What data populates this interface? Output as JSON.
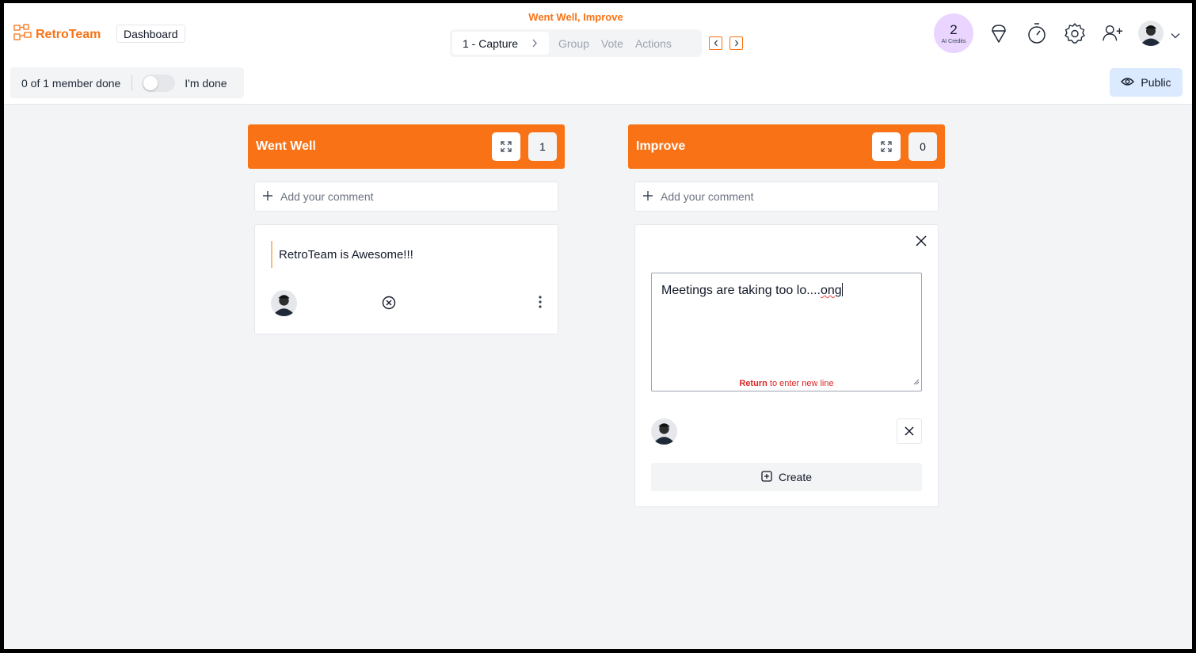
{
  "app": {
    "logo_text": "RetroTeam",
    "dashboard_label": "Dashboard",
    "board_title": "Went Well, Improve"
  },
  "steps": {
    "active": "1 - Capture",
    "items": [
      "Group",
      "Vote",
      "Actions"
    ]
  },
  "credits": {
    "count": "2",
    "label": "AI Credits"
  },
  "status": {
    "members_done": "0 of 1 member done",
    "done_toggle_label": "I'm done",
    "done_toggle_on": false
  },
  "visibility": {
    "label": "Public"
  },
  "columns": [
    {
      "title": "Went Well",
      "count": "1",
      "add_comment_placeholder": "Add your comment",
      "cards": [
        {
          "text": "RetroTeam is Awesome!!!"
        }
      ]
    },
    {
      "title": "Improve",
      "count": "0",
      "add_comment_placeholder": "Add your comment",
      "draft": {
        "text_before": "Meetings are taking too lo....",
        "text_misspelled": "ong",
        "hint_key": "Return",
        "hint_text": " to enter new line",
        "create_label": "Create"
      }
    }
  ],
  "colors": {
    "accent": "#f97316",
    "credits_bg": "#e9d5ff",
    "public_bg": "#dbeafe",
    "hint": "#dc2626"
  }
}
